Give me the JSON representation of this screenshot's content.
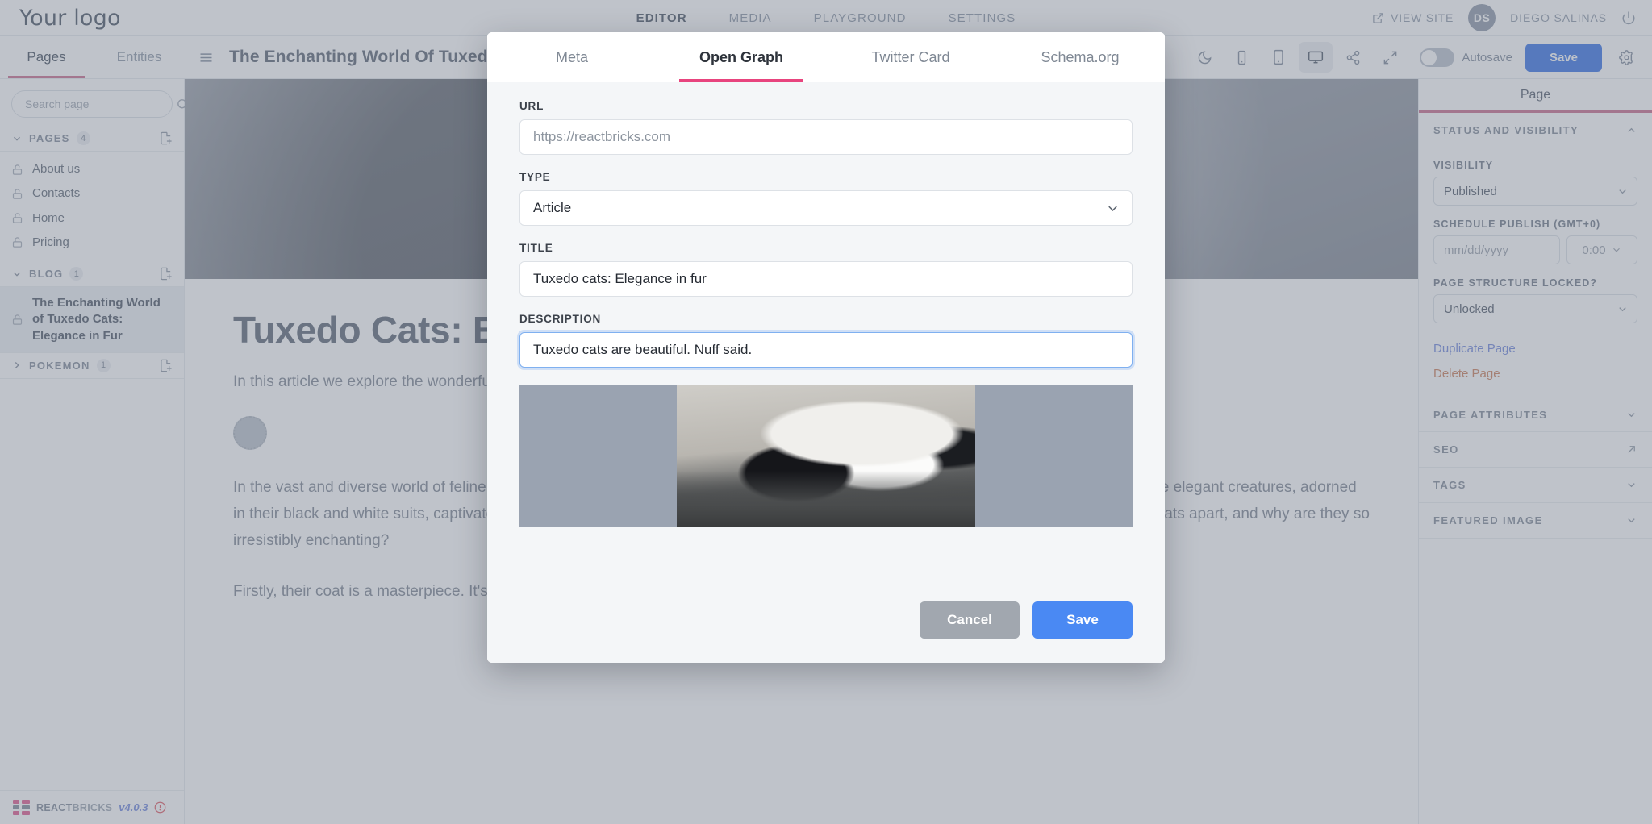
{
  "app": {
    "logo": "Your logo",
    "topnav": [
      {
        "label": "EDITOR",
        "active": true
      },
      {
        "label": "MEDIA",
        "active": false
      },
      {
        "label": "PLAYGROUND",
        "active": false
      },
      {
        "label": "SETTINGS",
        "active": false
      }
    ],
    "view_site": "VIEW SITE",
    "avatar_initials": "DS",
    "user_name": "DIEGO SALINAS"
  },
  "subbar": {
    "left_tabs": [
      {
        "label": "Pages",
        "active": true
      },
      {
        "label": "Entities",
        "active": false
      }
    ],
    "page_title": "The Enchanting World Of Tuxed",
    "icons": [
      {
        "name": "dark-mode-icon",
        "selected": false
      },
      {
        "name": "mobile-icon",
        "selected": false
      },
      {
        "name": "tablet-icon",
        "selected": false
      },
      {
        "name": "desktop-icon",
        "selected": true
      },
      {
        "name": "share-icon",
        "selected": false
      },
      {
        "name": "fullscreen-icon",
        "selected": false
      }
    ],
    "autosave_label": "Autosave",
    "autosave_on": false,
    "save_label": "Save"
  },
  "sidebar": {
    "search_placeholder": "Search page",
    "groups": [
      {
        "name": "PAGES",
        "count": "4",
        "expanded": true,
        "items": [
          {
            "label": "About us",
            "selected": false
          },
          {
            "label": "Contacts",
            "selected": false
          },
          {
            "label": "Home",
            "selected": false
          },
          {
            "label": "Pricing",
            "selected": false
          }
        ]
      },
      {
        "name": "BLOG",
        "count": "1",
        "expanded": true,
        "items": [
          {
            "label": "The Enchanting World of Tuxedo Cats: Elegance in Fur",
            "selected": true
          }
        ]
      },
      {
        "name": "POKEMON",
        "count": "1",
        "expanded": false,
        "items": []
      }
    ],
    "brand": {
      "name_bold": "REACT",
      "name_light": "BRICKS",
      "version": "v4.0.3"
    }
  },
  "content": {
    "heading": "Tuxedo Cats: Elegance in Fur",
    "lead": "In this article we explore the wonderful world of the tuxedo cats.",
    "paragraphs": [
      "In the vast and diverse world of feline companions, one particular breed stands out with charm and sophistication — the tuxedo cat. These elegant creatures, adorned in their black and white suits, captivate hearts with their distinctive appearance and delightful personalities. But what exactly sets tuxedo cats apart, and why are they so irresistibly enchanting?",
      "Firstly, their coat is a masterpiece. It's as if they are perpetually dressed for a grand ball,"
    ]
  },
  "right_panel": {
    "title": "Page",
    "sections": [
      {
        "name": "STATUS AND VISIBILITY",
        "state": "expanded",
        "chevron": "up"
      },
      {
        "name": "PAGE ATTRIBUTES",
        "state": "collapsed",
        "chevron": "down"
      },
      {
        "name": "SEO",
        "state": "external",
        "chevron": "external"
      },
      {
        "name": "TAGS",
        "state": "collapsed",
        "chevron": "down"
      },
      {
        "name": "FEATURED IMAGE",
        "state": "collapsed",
        "chevron": "down"
      }
    ],
    "visibility_label": "VISIBILITY",
    "visibility_value": "Published",
    "schedule_label": "SCHEDULE PUBLISH (GMT+0)",
    "schedule_date_placeholder": "mm/dd/yyyy",
    "schedule_time_value": "0:00",
    "locked_label": "PAGE STRUCTURE LOCKED?",
    "locked_value": "Unlocked",
    "duplicate_page": "Duplicate Page",
    "delete_page": "Delete Page"
  },
  "modal": {
    "tabs": [
      {
        "label": "Meta",
        "active": false
      },
      {
        "label": "Open Graph",
        "active": true
      },
      {
        "label": "Twitter Card",
        "active": false
      },
      {
        "label": "Schema.org",
        "active": false
      }
    ],
    "fields": {
      "url_label": "URL",
      "url_value": "",
      "url_placeholder": "https://reactbricks.com",
      "type_label": "TYPE",
      "type_value": "Article",
      "title_label": "TITLE",
      "title_value": "Tuxedo cats: Elegance in fur",
      "description_label": "DESCRIPTION",
      "description_value": "Tuxedo cats are beautiful. Nuff said."
    },
    "cancel_label": "Cancel",
    "save_label": "Save"
  },
  "colors": {
    "accent_pink": "#e8447e",
    "tab_underline": "#cf7a98",
    "primary_blue": "#4a89f3",
    "cancel_gray": "#a1a7af"
  }
}
